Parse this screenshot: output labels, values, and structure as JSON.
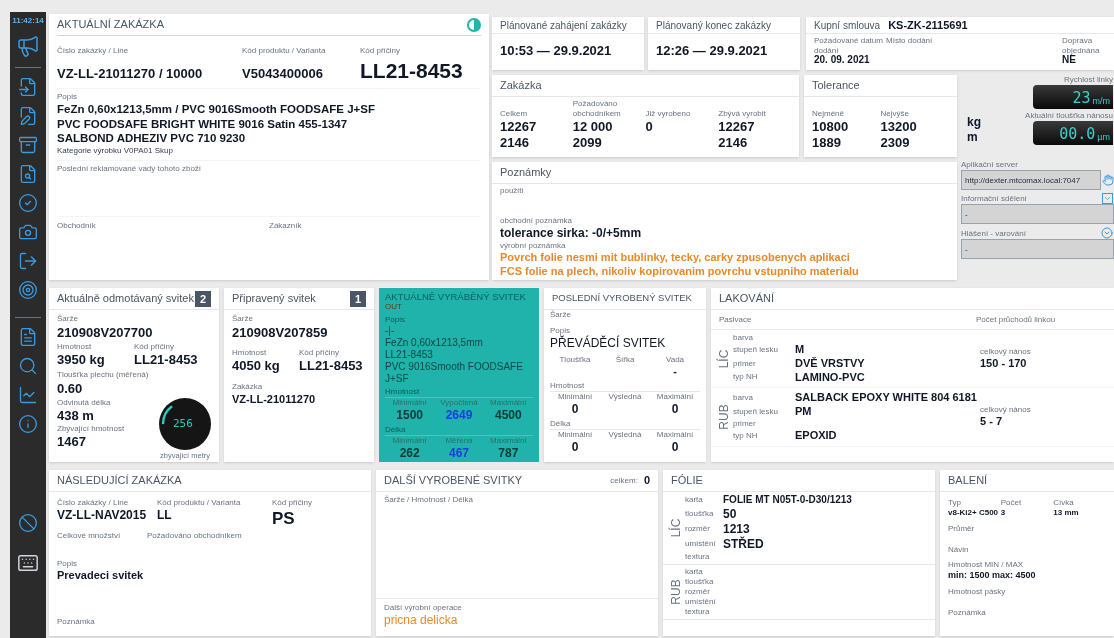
{
  "sidebar": {
    "time": "11:42:14"
  },
  "current_order": {
    "title": "AKTUÁLNÍ ZAKÁZKA",
    "fields": [
      {
        "label": "Číslo zakázky / Line",
        "value": "VZ-LL-21011270 / 10000"
      },
      {
        "label": "Kód produktu / Varianta",
        "value": "V5043400006"
      },
      {
        "label": "Kód příčiny",
        "value": "LL21-8453"
      }
    ],
    "description_label": "Popis",
    "description": [
      "FeZn 0,60x1213,5mm / PVC 9016Smooth FOODSAFE J+SF",
      "PVC FOODSAFE BRIGHT WHITE 9016 Satin 455-1347",
      "SALBOND ADHEZIV PVC 710 9230"
    ],
    "category": "Kategorie výrobku V0PA01 Skup",
    "defects_label": "Poslední reklamované vady tohoto zboží",
    "trader_label": "Obchodník",
    "customer_label": "Zákazník"
  },
  "planned_start": {
    "title": "Plánované zahájení zakázky",
    "value": "10:53 — 29.9.2021"
  },
  "planned_end": {
    "title": "Plánovaný konec zakázky",
    "value": "12:26 — 29.9.2021"
  },
  "contract": {
    "title": "Kupní smlouva",
    "number": "KS-ZK-2115691",
    "fields": [
      {
        "label": "Požadované datum dodání",
        "value": "20. 09. 2021"
      },
      {
        "label": "Místo dodání"
      },
      {
        "label": "Doprava objednána",
        "value": "NE"
      }
    ]
  },
  "order": {
    "title": "Zakázka",
    "columns": [
      "Celkem",
      "Požadováno obchodníkem",
      "Již vyrobeno",
      "Zbývá vyrobit"
    ],
    "rows": [
      [
        "12267",
        "12 000",
        "0",
        "12267"
      ],
      [
        "2146",
        "2099",
        null,
        "2146"
      ]
    ]
  },
  "tolerance": {
    "title": "Tolerance",
    "columns": [
      "Nejméně",
      "Nejvýše"
    ],
    "rows": [
      [
        "10800",
        "13200"
      ],
      [
        "1889",
        "2309"
      ]
    ]
  },
  "units": [
    "kg",
    "m"
  ],
  "gauges": [
    {
      "label": "Rychlost linky",
      "value": "23",
      "unit": "m/m"
    },
    {
      "label": "Aktuální tloušťka nánosu",
      "value": "00.0",
      "unit": "µm"
    }
  ],
  "notes": {
    "title": "Poznámky",
    "usage_label": "použití",
    "trade_label": "obchodní poznámka",
    "trade_note": "tolerance sirka: -0/+5mm",
    "production_label": "výrobní poznámka",
    "production_note": [
      "Povrch folie nesmi mit bublinky, tecky, carky zpusobenych aplikaci",
      "FCS folie na plech, nikoliv kopirovanim povrchu vstupniho materialu"
    ]
  },
  "server": {
    "label": "Aplikační server",
    "value": "http://dexter.mtcomax.local:7047"
  },
  "info": {
    "label": "Informační sdělení",
    "value": "-"
  },
  "warning": {
    "label": "Hlášení - varování",
    "value": "-"
  },
  "unwinding": {
    "title": "Aktuálně odmotávaný svitek",
    "badge": "2",
    "batch_label": "Šarže",
    "batch": "210908V207700",
    "weight_label": "Hmotnost",
    "weight": "3950 kg",
    "cause_label": "Kód příčiny",
    "cause": "LL21-8453",
    "thickness_label": "Tloušťka plechu (měřená)",
    "thickness": "0.60",
    "length_label": "Odvinutá délka",
    "length": "438 m",
    "remaining_label": "Zbývající hmotnost",
    "remaining": "1467",
    "meter": {
      "value": "256",
      "caption": "zbývající metry",
      "level": 0.15
    }
  },
  "prepared": {
    "title": "Připravený svitek",
    "badge": "1",
    "batch_label": "Šarže",
    "batch": "210908V207859",
    "weight_label": "Hmotnost",
    "weight": "4050 kg",
    "cause_label": "Kód příčiny",
    "cause": "LL21-8453",
    "order_label": "Zakázka",
    "order": "VZ-LL-21011270"
  },
  "producing": {
    "title": "AKTUÁLNĚ VYRÁBĚNÝ SVITEK",
    "tag": "OUT",
    "description_label": "Popis",
    "description": [
      "-|-",
      "FeZn 0,60x1213,5mm",
      "LL21-8453",
      "PVC 9016Smooth FOODSAFE J+SF"
    ],
    "groups": [
      {
        "label": "Hmotnost",
        "cells": [
          {
            "label": "Minimální",
            "value": "1500",
            "kind": "plain"
          },
          {
            "label": "Vypočtená",
            "value": "2649",
            "kind": "highlight"
          },
          {
            "label": "Maximální",
            "value": "4500",
            "kind": "plain"
          }
        ]
      },
      {
        "label": "Délka",
        "cells": [
          {
            "label": "Minimální",
            "value": "262",
            "kind": "plain"
          },
          {
            "label": "Měřená",
            "value": "467",
            "kind": "highlight"
          },
          {
            "label": "Maximální",
            "value": "787",
            "kind": "plain"
          }
        ]
      }
    ]
  },
  "last": {
    "title": "POSLEDNÍ VYROBENÝ SVITEK",
    "batch_label": "Šarže",
    "description_label": "Popis",
    "description": "PŘEVÁDĚCÍ SVITEK",
    "specs": [
      {
        "label": "Tloušťka"
      },
      {
        "label": "Šířka"
      },
      {
        "label": "Vada",
        "value": "-"
      }
    ],
    "groups": [
      {
        "label": "Hmotnost",
        "cells": [
          {
            "label": "Minimální",
            "value": "0",
            "kind": "plain"
          },
          {
            "label": "Výsledná",
            "kind": "plain"
          },
          {
            "label": "Maximální",
            "value": "0",
            "kind": "plain"
          }
        ]
      },
      {
        "label": "Délka",
        "cells": [
          {
            "label": "Minimální",
            "value": "0",
            "kind": "plain"
          },
          {
            "label": "Výsledná",
            "kind": "plain"
          },
          {
            "label": "Maximální",
            "value": "0",
            "kind": "plain"
          }
        ]
      }
    ]
  },
  "coating": {
    "title": "LAKOVÁNÍ",
    "passivation_label": "Pasivace",
    "passes_label": "Počet průchodů linkou",
    "sides": [
      {
        "side": "LÍC",
        "rows": [
          {
            "label": "barva"
          },
          {
            "label": "stupeň lesku",
            "value": "M"
          },
          {
            "label": "primer",
            "value": "DVĚ VRSTVY"
          },
          {
            "label": "typ NH",
            "value": "LAMINO-PVC"
          }
        ],
        "total_label": "celkový nános",
        "total": "150 - 170"
      },
      {
        "side": "RUB",
        "rows": [
          {
            "label": "barva",
            "value": "SALBACK EPOXY WHITE 804 6181"
          },
          {
            "label": "stupeň lesku",
            "value": "PM"
          },
          {
            "label": "primer"
          },
          {
            "label": "typ NH",
            "value": "EPOXID"
          }
        ],
        "total_label": "celkový nános",
        "total": "5 - 7"
      }
    ]
  },
  "next_order": {
    "title": "NÁSLEDUJÍCÍ ZAKÁZKA",
    "fields": [
      {
        "label": "Číslo zakázky / Line",
        "value": "VZ-LL-NAV2015"
      },
      {
        "label": "Kód produktu / Varianta",
        "value": "LL"
      },
      {
        "label": "Kód příčiny",
        "value": "PS"
      }
    ],
    "qty_labels": [
      "Celkové množství",
      "Požadováno obchodníkem"
    ],
    "description_label": "Popis",
    "description": "Prevadeci svitek",
    "note_label": "Poznámka"
  },
  "more_coils": {
    "title": "DALŠÍ VYROBENÉ SVITKY",
    "total_label": "celkem:",
    "total": "0",
    "list_label": "Šarže / Hmotnost / Délka",
    "next_op_label": "Další výrobní operace",
    "next_op": "pricna delicka"
  },
  "foil": {
    "title": "FÓLIE",
    "sides": [
      {
        "side": "LÍC",
        "rows": [
          {
            "label": "karta",
            "value": "FOLIE MT N05T-0-D30/1213"
          },
          {
            "label": "tloušťka",
            "value": "50"
          },
          {
            "label": "rozměr",
            "value": "1213"
          },
          {
            "label": "umístění",
            "value": "STŘED"
          },
          {
            "label": "textura"
          }
        ]
      },
      {
        "side": "RUB",
        "rows": [
          {
            "label": "karta"
          },
          {
            "label": "tloušťka"
          },
          {
            "label": "rozměr"
          },
          {
            "label": "umístění"
          },
          {
            "label": "textura"
          }
        ]
      }
    ]
  },
  "packing": {
    "title": "BALENÍ",
    "fields": [
      {
        "label": "Typ",
        "value": "v8-Ki2+ C500"
      },
      {
        "label": "Počet",
        "value": "3"
      },
      {
        "label": "Cívka",
        "value": "13 mm"
      }
    ],
    "rows": [
      {
        "label": "Průměr"
      },
      {
        "label": "Návin"
      },
      {
        "label": "Hmotnost MIN / MAX",
        "value": "min: 1500 max: 4500"
      },
      {
        "label": "Hmotnost pásky"
      },
      {
        "label": "Poznámka"
      }
    ]
  }
}
